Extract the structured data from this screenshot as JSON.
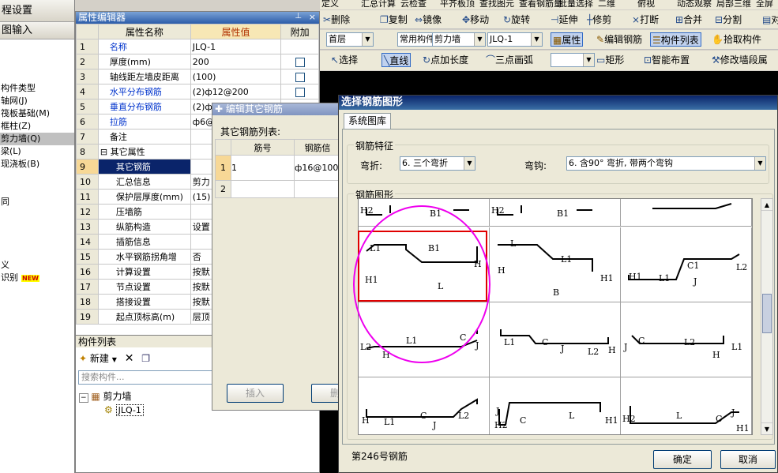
{
  "left_panel": {
    "header1": "程设置",
    "header2": "图输入",
    "items": [
      "构件类型",
      "轴网(J)",
      "筏板基础(M)",
      "框柱(Z)",
      "剪力墙(Q)",
      "梁(L)",
      "现浇板(B)",
      "",
      "",
      "同",
      "",
      "",
      "",
      "",
      "义",
      "识别"
    ],
    "new_badge": "NEW"
  },
  "property_editor": {
    "title": "属性编辑器",
    "columns": {
      "name": "属性名称",
      "value": "属性值",
      "extra": "附加"
    },
    "rows": [
      {
        "n": "1",
        "name": "名称",
        "value": "JLQ-1",
        "blue": true,
        "check": false
      },
      {
        "n": "2",
        "name": "厚度(mm)",
        "value": "200",
        "blue": false,
        "check": true
      },
      {
        "n": "3",
        "name": "轴线距左墙皮距离",
        "value": "(100)",
        "blue": false,
        "check": true
      },
      {
        "n": "4",
        "name": "水平分布钢筋",
        "value": "(2)ф12@200",
        "blue": true,
        "check": true
      },
      {
        "n": "5",
        "name": "垂直分布钢筋",
        "value": "(2)ф",
        "blue": true,
        "check": true
      },
      {
        "n": "6",
        "name": "拉筋",
        "value": "ф6@",
        "blue": true,
        "check": false
      },
      {
        "n": "7",
        "name": "备注",
        "value": "",
        "blue": false,
        "check": false
      },
      {
        "n": "8",
        "name": "⊟ 其它属性",
        "value": "",
        "blue": false,
        "check": false
      },
      {
        "n": "9",
        "name": "其它钢筋",
        "value": "",
        "blue": false,
        "check": false
      },
      {
        "n": "10",
        "name": "汇总信息",
        "value": "剪力",
        "blue": false,
        "check": false
      },
      {
        "n": "11",
        "name": "保护层厚度(mm)",
        "value": "(15)",
        "blue": false,
        "check": false
      },
      {
        "n": "12",
        "name": "压墙筋",
        "value": "",
        "blue": false,
        "check": false
      },
      {
        "n": "13",
        "name": "纵筋构造",
        "value": "设置",
        "blue": false,
        "check": false
      },
      {
        "n": "14",
        "name": "插筋信息",
        "value": "",
        "blue": false,
        "check": false
      },
      {
        "n": "15",
        "name": "水平钢筋拐角增",
        "value": "否",
        "blue": false,
        "check": false
      },
      {
        "n": "16",
        "name": "计算设置",
        "value": "按默",
        "blue": false,
        "check": false
      },
      {
        "n": "17",
        "name": "节点设置",
        "value": "按默",
        "blue": false,
        "check": false
      },
      {
        "n": "18",
        "name": "搭接设置",
        "value": "按默",
        "blue": false,
        "check": false
      },
      {
        "n": "19",
        "name": "起点顶标高(m)",
        "value": "层顶",
        "blue": false,
        "check": false
      }
    ]
  },
  "component_list": {
    "title": "构件列表",
    "new_label": "新建",
    "search_placeholder": "搜索构件...",
    "tree_root": "剪力墙",
    "tree_child": "JLQ-1"
  },
  "toolbar_top": {
    "row0": [
      "定义",
      "汇总计算",
      "云检查",
      "平齐板顶",
      "查找图元",
      "查看钢筋量",
      "批量选择",
      "二维",
      "俯视",
      "动态观察",
      "局部三维",
      "全屏"
    ],
    "row1": [
      "删除",
      "复制",
      "镜像",
      "移动",
      "旋转",
      "延伸",
      "修剪",
      "打断",
      "合并",
      "分割",
      "对"
    ],
    "row2_combos": [
      "首层",
      "常用构件类",
      "剪力墙",
      "JLQ-1"
    ],
    "row2_buttons": [
      "属性",
      "编辑钢筋",
      "构件列表",
      "拾取构件"
    ],
    "row3": [
      "选择",
      "直线",
      "点加长度",
      "三点画弧",
      "矩形",
      "智能布置",
      "修改墙段属"
    ]
  },
  "edit_dialog": {
    "title": "编辑其它钢筋",
    "list_label": "其它钢筋列表:",
    "columns": [
      "筋号",
      "钢筋信"
    ],
    "rows": [
      {
        "n": "1",
        "code": "1",
        "info": "ф16@100"
      },
      {
        "n": "2",
        "code": "",
        "info": ""
      }
    ],
    "insert_btn": "插入",
    "delete_btn": "删除"
  },
  "shape_dialog": {
    "title": "选择钢筋图形",
    "tab": "系统图库",
    "feature_group": "钢筋特征",
    "bend_label": "弯折:",
    "bend_value": "6. 三个弯折",
    "hook_label": "弯钩:",
    "hook_value": "6. 含90° 弯折, 带两个弯钩",
    "shape_group": "钢筋图形",
    "status": "第246号钢筋",
    "ok": "确定",
    "cancel": "取消",
    "cells": [
      {
        "labels": [
          "H2",
          "B1"
        ]
      },
      {
        "labels": [
          "H2",
          "B1"
        ]
      },
      {
        "labels": []
      },
      {
        "labels": [
          "L1",
          "B1",
          "H1",
          "L",
          "H"
        ]
      },
      {
        "labels": [
          "L",
          "L1",
          "H",
          "B",
          "H1"
        ]
      },
      {
        "labels": [
          "H1",
          "L1",
          "C1",
          "J",
          "L2"
        ]
      },
      {
        "labels": [
          "L2",
          "L1",
          "C",
          "J",
          "H"
        ]
      },
      {
        "labels": [
          "L1",
          "C",
          "J",
          "L2",
          "H"
        ]
      },
      {
        "labels": [
          "J",
          "C",
          "L2",
          "H",
          "L1"
        ]
      },
      {
        "labels": [
          "H",
          "L1",
          "C",
          "J",
          "L2"
        ]
      },
      {
        "labels": [
          "J",
          "H2",
          "C",
          "L",
          "H1"
        ]
      },
      {
        "labels": [
          "H2",
          "L",
          "C",
          "J",
          "H1"
        ]
      }
    ]
  }
}
